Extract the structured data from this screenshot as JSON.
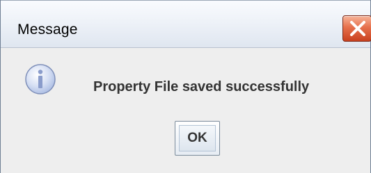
{
  "window": {
    "title": "Message"
  },
  "titlebar": {
    "close_icon": "close-icon"
  },
  "dialog": {
    "icon": "info-icon",
    "message": "Property File saved successfully",
    "ok_label": "OK"
  },
  "colors": {
    "close_button": "#d9552f",
    "info_icon_fill": "#c9d6f0",
    "dialog_background": "#eeeeee"
  }
}
